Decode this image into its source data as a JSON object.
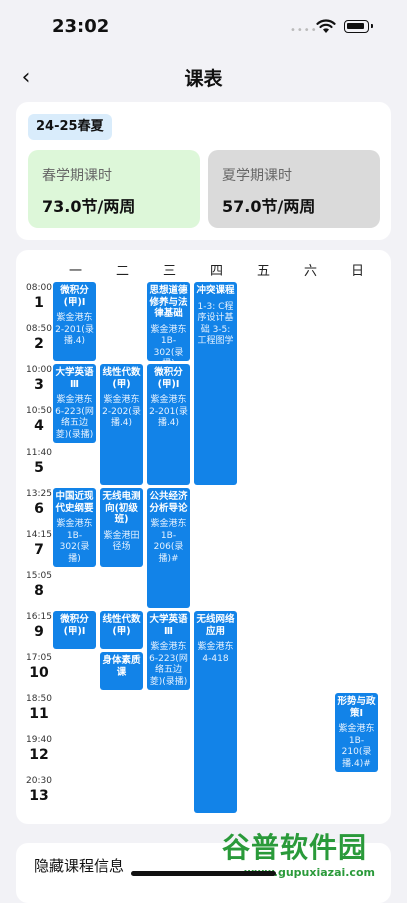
{
  "status_bar": {
    "time": "23:02"
  },
  "nav": {
    "back_icon": "‹",
    "title": "课表"
  },
  "term": {
    "badge": "24-25春夏",
    "spring": {
      "label": "春学期课时",
      "value": "73.0节/两周"
    },
    "summer": {
      "label": "夏学期课时",
      "value": "57.0节/两周"
    }
  },
  "timetable": {
    "days": [
      "一",
      "二",
      "三",
      "四",
      "五",
      "六",
      "日"
    ],
    "slots": [
      {
        "time": "08:00",
        "num": "1"
      },
      {
        "time": "08:50",
        "num": "2"
      },
      {
        "time": "10:00",
        "num": "3"
      },
      {
        "time": "10:50",
        "num": "4"
      },
      {
        "time": "11:40",
        "num": "5"
      },
      {
        "time": "13:25",
        "num": "6"
      },
      {
        "time": "14:15",
        "num": "7"
      },
      {
        "time": "15:05",
        "num": "8"
      },
      {
        "time": "16:15",
        "num": "9"
      },
      {
        "time": "17:05",
        "num": "10"
      },
      {
        "time": "18:50",
        "num": "11"
      },
      {
        "time": "19:40",
        "num": "12"
      },
      {
        "time": "20:30",
        "num": "13"
      }
    ],
    "classes": [
      {
        "day": 1,
        "start": 1,
        "end": 2,
        "name": "微积分(甲)Ⅰ",
        "room": "紫金港东2-201(录播.4)"
      },
      {
        "day": 1,
        "start": 3,
        "end": 4,
        "name": "大学英语Ⅲ",
        "room": "紫金港东6-223(网络五边菱)(录播)"
      },
      {
        "day": 1,
        "start": 6,
        "end": 7,
        "name": "中国近现代史纲要",
        "room": "紫金港东1B-302(录播)"
      },
      {
        "day": 1,
        "start": 9,
        "end": 9,
        "name": "微积分(甲)Ⅰ",
        "room": ""
      },
      {
        "day": 2,
        "start": 3,
        "end": 5,
        "name": "线性代数(甲)",
        "room": "紫金港东2-202(录播.4)"
      },
      {
        "day": 2,
        "start": 6,
        "end": 7,
        "name": "无线电测向(初级班)",
        "room": "紫金港田径场"
      },
      {
        "day": 2,
        "start": 9,
        "end": 9,
        "name": "线性代数(甲)",
        "room": ""
      },
      {
        "day": 2,
        "start": 10,
        "end": 10,
        "name": "身体素质课",
        "room": ""
      },
      {
        "day": 3,
        "start": 1,
        "end": 2,
        "name": "思想道德修养与法律基础",
        "room": "紫金港东1B-302(录播)"
      },
      {
        "day": 3,
        "start": 3,
        "end": 5,
        "name": "微积分(甲)Ⅰ",
        "room": "紫金港东2-201(录播.4)"
      },
      {
        "day": 3,
        "start": 6,
        "end": 8,
        "name": "公共经济分析导论",
        "room": "紫金港东1B-206(录播)#"
      },
      {
        "day": 3,
        "start": 9,
        "end": 10,
        "name": "大学英语Ⅲ",
        "room": "紫金港东6-223(网络五边菱)(录播)"
      },
      {
        "day": 4,
        "start": 1,
        "end": 5,
        "name": "冲突课程",
        "room": "1-3: C程序设计基础 3-5: 工程图学"
      },
      {
        "day": 4,
        "start": 9,
        "end": 13,
        "name": "无线网络应用",
        "room": "紫金港东4-418"
      },
      {
        "day": 7,
        "start": 11,
        "end": 12,
        "name": "形势与政策Ⅰ",
        "room": "紫金港东1B-210(录播.4)#"
      }
    ]
  },
  "hidden_section": {
    "title": "隐藏课程信息"
  },
  "watermark": {
    "big": "谷普软件园",
    "small": "www.gupuxiazai.com"
  },
  "colors": {
    "class_block": "#1283e8",
    "spring_bg": "#ddf7d9",
    "summer_bg": "#dadada",
    "badge_bg": "#d9ecfb",
    "watermark": "#2a9a3a"
  }
}
